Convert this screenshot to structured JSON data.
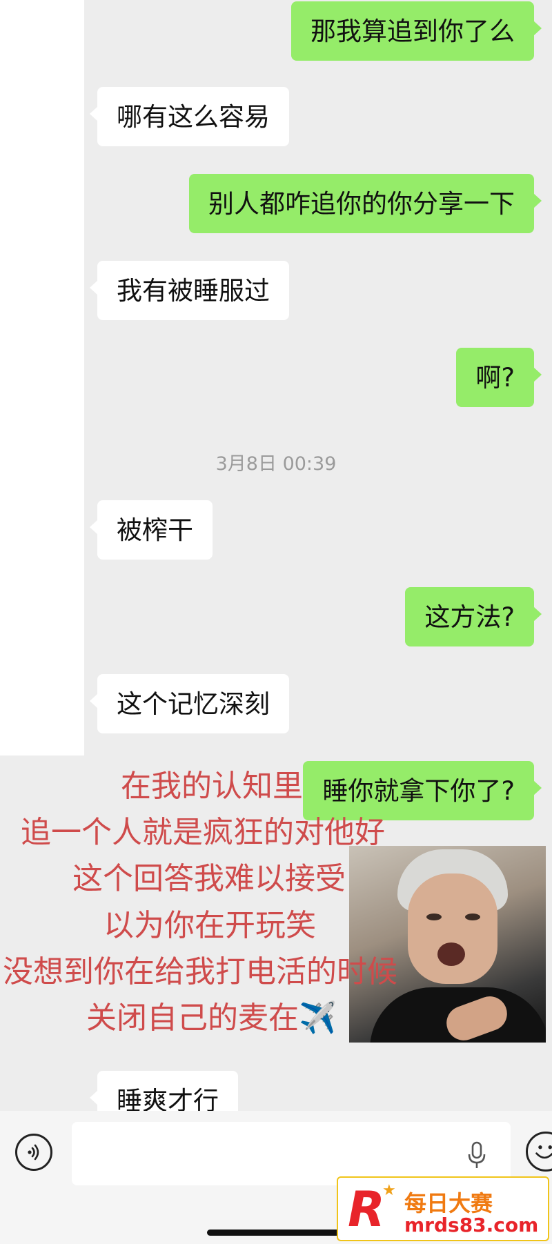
{
  "chat": {
    "messages": [
      {
        "side": "out",
        "text": "那我算追到你了么"
      },
      {
        "side": "in",
        "text": "哪有这么容易"
      },
      {
        "side": "out",
        "text": "别人都咋追你的你分享一下"
      },
      {
        "side": "in",
        "text": "我有被睡服过"
      },
      {
        "side": "out",
        "text": "啊?"
      },
      {
        "side": "in",
        "text": "被榨干"
      },
      {
        "side": "out",
        "text": "这方法?"
      },
      {
        "side": "in",
        "text": "这个记忆深刻"
      },
      {
        "side": "out",
        "text": "睡你就拿下你了?"
      },
      {
        "side": "in",
        "text": "睡爽才行"
      }
    ],
    "timestamp": "3月8日 00:39"
  },
  "overlay": {
    "lines": [
      "在我的认知里",
      "追一个人就是疯狂的对他好",
      "这个回答我难以接受",
      "以为你在开玩笑",
      "没想到你在给我打电活的时候",
      "关闭自己的麦在✈️"
    ],
    "color": "#cf4b4b"
  },
  "input_bar": {
    "voice_icon": "voice-mode-icon",
    "mic_icon": "microphone-icon",
    "emoji_icon": "emoji-icon"
  },
  "watermark": {
    "logo": "R",
    "title": "每日大赛",
    "site": "mrds83.com"
  },
  "colors": {
    "background": "#ededed",
    "incoming_bubble": "#ffffff",
    "outgoing_bubble": "#95ec69"
  }
}
